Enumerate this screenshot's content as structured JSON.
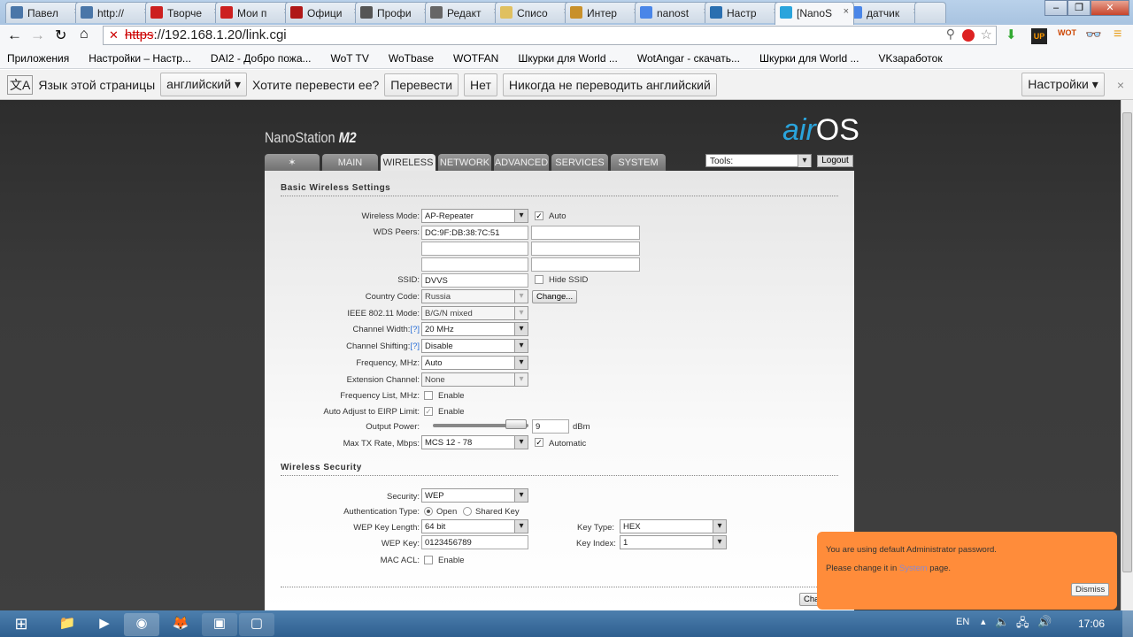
{
  "browser": {
    "tabs": [
      {
        "label": "Павел",
        "icon": "vk-icon",
        "color": "#4a76a8"
      },
      {
        "label": "http://",
        "icon": "vk-icon",
        "color": "#4a76a8"
      },
      {
        "label": "Творче",
        "icon": "youtube-icon",
        "color": "#cc2020"
      },
      {
        "label": "Мои п",
        "icon": "youtube-icon",
        "color": "#cc2020"
      },
      {
        "label": "Офици",
        "icon": "wargaming-icon",
        "color": "#b01818"
      },
      {
        "label": "Профи",
        "icon": "wot-icon",
        "color": "#555"
      },
      {
        "label": "Редакт",
        "icon": "edit-icon",
        "color": "#666"
      },
      {
        "label": "Списо",
        "icon": "loading-icon",
        "color": "#e0c060"
      },
      {
        "label": "Интер",
        "icon": "page-icon",
        "color": "#c8902a"
      },
      {
        "label": "nanost",
        "icon": "google-icon",
        "color": "#4a86e8"
      },
      {
        "label": "Настр",
        "icon": "globe-icon",
        "color": "#2a6fb0"
      },
      {
        "label": "[NanoS",
        "icon": "wifi-icon",
        "color": "#2aa4dc"
      },
      {
        "label": "датчик",
        "icon": "google-icon",
        "color": "#4a86e8"
      }
    ],
    "url_scheme": "https",
    "url_rest": "://192.168.1.20/link.cgi",
    "bookmarks": [
      "Приложения",
      "Настройки – Настр...",
      "DAI2 - Добро пожа...",
      "WoT TV",
      "WoTbase",
      "WOTFAN",
      "Шкурки для World ...",
      "WotAngar - скачать...",
      "Шкурки для World ...",
      "VKзаработок"
    ],
    "translate": {
      "label": "Язык этой страницы",
      "lang": "английский",
      "question": "Хотите перевести ее?",
      "translate": "Перевести",
      "no": "Нет",
      "never": "Никогда не переводить английский",
      "settings": "Настройки"
    }
  },
  "app": {
    "brand": "NanoStation",
    "model": "M2",
    "logo_a": "air",
    "logo_b": "OS",
    "nav": [
      "MAIN",
      "WIRELESS",
      "NETWORK",
      "ADVANCED",
      "SERVICES",
      "SYSTEM"
    ],
    "tools": "Tools:",
    "logout": "Logout",
    "basic": {
      "title": "Basic Wireless Settings",
      "wireless_mode": {
        "label": "Wireless Mode:",
        "value": "AP-Repeater",
        "auto": "Auto"
      },
      "wds": {
        "label": "WDS Peers:",
        "peers": [
          "DC:9F:DB:38:7C:51",
          "",
          "",
          "",
          "",
          ""
        ]
      },
      "ssid": {
        "label": "SSID:",
        "value": "DVVS",
        "hide": "Hide SSID"
      },
      "country": {
        "label": "Country Code:",
        "value": "Russia",
        "change": "Change..."
      },
      "ieee": {
        "label": "IEEE 802.11 Mode:",
        "value": "B/G/N mixed"
      },
      "chwidth": {
        "label": "Channel Width:",
        "help": "[?]",
        "value": "20 MHz"
      },
      "chshift": {
        "label": "Channel Shifting:",
        "help": "[?]",
        "value": "Disable"
      },
      "freq": {
        "label": "Frequency, MHz:",
        "value": "Auto"
      },
      "ext": {
        "label": "Extension Channel:",
        "value": "None"
      },
      "freqlist": {
        "label": "Frequency List, MHz:",
        "enable": "Enable"
      },
      "eirp": {
        "label": "Auto Adjust to EIRP Limit:",
        "enable": "Enable"
      },
      "power": {
        "label": "Output Power:",
        "value": "9",
        "unit": "dBm"
      },
      "txrate": {
        "label": "Max TX Rate, Mbps:",
        "value": "MCS 12 - 78",
        "auto": "Automatic"
      }
    },
    "security": {
      "title": "Wireless Security",
      "security": {
        "label": "Security:",
        "value": "WEP"
      },
      "auth": {
        "label": "Authentication Type:",
        "open": "Open",
        "shared": "Shared Key"
      },
      "keylen": {
        "label": "WEP Key Length:",
        "value": "64 bit"
      },
      "keytype": {
        "label": "Key Type:",
        "value": "HEX"
      },
      "key": {
        "label": "WEP Key:",
        "value": "0123456789"
      },
      "keyindex": {
        "label": "Key Index:",
        "value": "1"
      },
      "macacl": {
        "label": "MAC ACL:",
        "enable": "Enable"
      }
    },
    "change_btn": "Cha",
    "toast": {
      "line1": "You are using default Administrator password.",
      "line2a": "Please change it in",
      "link": "System",
      "line2b": "page.",
      "dismiss": "Dismiss"
    }
  },
  "taskbar": {
    "lang": "EN",
    "time": "17:06"
  }
}
